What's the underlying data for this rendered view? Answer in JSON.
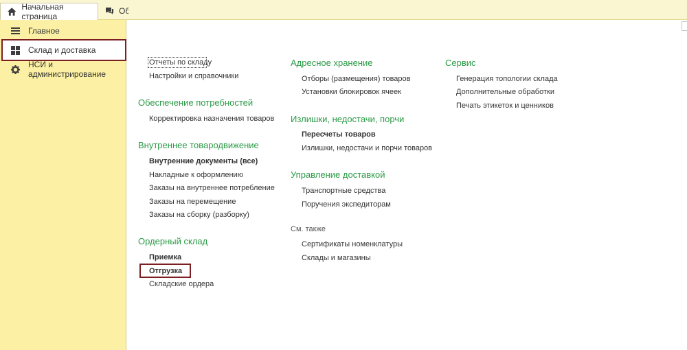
{
  "tabs": {
    "home": "Начальная страница",
    "other": "Об"
  },
  "sidebar": {
    "items": [
      {
        "label": "Главное",
        "icon": "menu-lines-icon"
      },
      {
        "label": "Склад и доставка",
        "icon": "grid-icon"
      },
      {
        "label": "НСИ и администрирование",
        "icon": "gear-icon"
      }
    ],
    "selected_index": 1
  },
  "columns": {
    "col1": {
      "top_links": [
        "Отчеты по складу",
        "Настройки и справочники"
      ],
      "sections": [
        {
          "title": "Обеспечение потребностей",
          "links": [
            "Корректировка назначения товаров"
          ]
        },
        {
          "title": "Внутреннее товародвижение",
          "links": [
            "Внутренние документы (все)",
            "Накладные к оформлению",
            "Заказы на внутреннее потребление",
            "Заказы на перемещение",
            "Заказы на сборку (разборку)"
          ]
        },
        {
          "title": "Ордерный склад",
          "links": [
            "Приемка",
            "Отгрузка",
            "Складские ордера"
          ]
        }
      ]
    },
    "col2": {
      "sections": [
        {
          "title": "Адресное хранение",
          "links": [
            "Отборы (размещения) товаров",
            "Установки блокировок ячеек"
          ]
        },
        {
          "title": "Излишки, недостачи, порчи",
          "links": [
            "Пересчеты товаров",
            "Излишки, недостачи и порчи товаров"
          ]
        },
        {
          "title": "Управление доставкой",
          "links": [
            "Транспортные средства",
            "Поручения экспедиторам"
          ]
        }
      ],
      "see_also_label": "См. также",
      "see_also_links": [
        "Сертификаты номенклатуры",
        "Склады и магазины"
      ]
    },
    "col3": {
      "sections": [
        {
          "title": "Сервис",
          "links": [
            "Генерация топологии склада",
            "Дополнительные обработки",
            "Печать этикеток и ценников"
          ]
        }
      ]
    }
  },
  "colors": {
    "accent_green": "#2a9a45",
    "sidebar_bg": "#fbf0a3",
    "highlight_frame": "#7b1f22"
  }
}
